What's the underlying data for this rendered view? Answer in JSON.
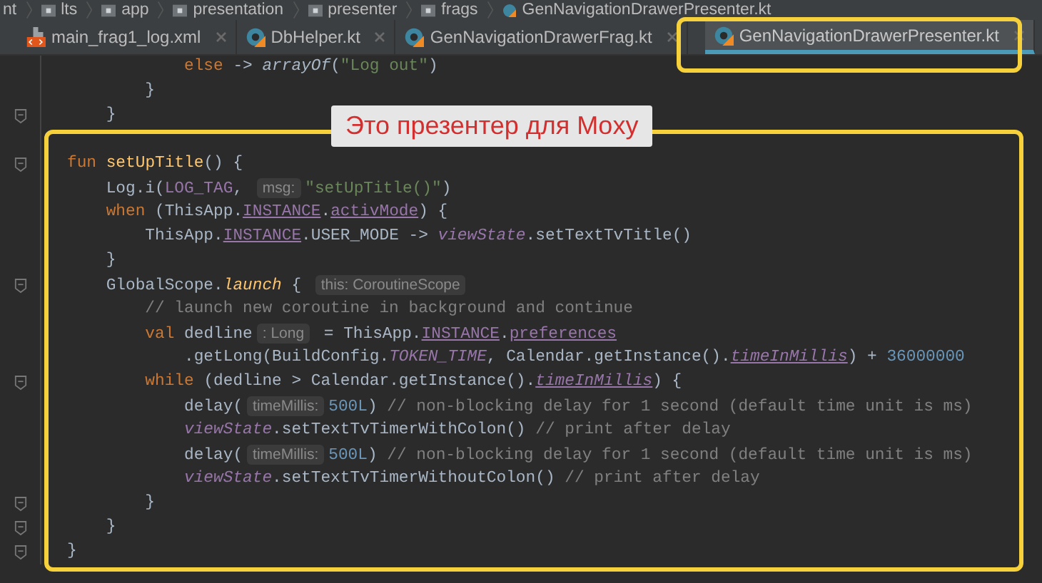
{
  "breadcrumbs": [
    {
      "label": "nt",
      "kind": "plain"
    },
    {
      "label": "lts",
      "kind": "folder"
    },
    {
      "label": "app",
      "kind": "folder"
    },
    {
      "label": "presentation",
      "kind": "folder"
    },
    {
      "label": "presenter",
      "kind": "folder"
    },
    {
      "label": "frags",
      "kind": "folder"
    },
    {
      "label": "GenNavigationDrawerPresenter.kt",
      "kind": "kotlin"
    }
  ],
  "tabs": [
    {
      "label": "main_frag1_log.xml",
      "kind": "xml",
      "selected": false
    },
    {
      "label": "DbHelper.kt",
      "kind": "kotlin",
      "selected": false
    },
    {
      "label": "GenNavigationDrawerFrag.kt",
      "kind": "kotlin",
      "selected": false
    },
    {
      "label": "GenNavigationDrawerPresenter.kt",
      "kind": "kotlin",
      "selected": true
    }
  ],
  "code": [
    {
      "fold": false,
      "tokens": [
        {
          "t": "            else",
          "kind": "keyword"
        },
        {
          "t": " -> ",
          "kind": "plain"
        },
        {
          "t": "arrayOf",
          "kind": "call-i"
        },
        {
          "t": "(",
          "kind": "plain"
        },
        {
          "t": "\"Log out\"",
          "kind": "string"
        },
        {
          "t": ")",
          "kind": "plain"
        }
      ]
    },
    {
      "fold": false,
      "tokens": [
        {
          "t": "        }",
          "kind": "plain"
        }
      ]
    },
    {
      "fold": true,
      "tokens": [
        {
          "t": "    }",
          "kind": "plain"
        }
      ]
    },
    {
      "fold": false
    },
    {
      "fold": true,
      "tokens": [
        {
          "t": "fun",
          "kind": "keyword"
        },
        {
          "t": " setUpTitle",
          "kind": "decl"
        },
        {
          "t": "() {",
          "kind": "plain"
        }
      ]
    },
    {
      "fold": false,
      "tokens": [
        {
          "t": "    Log.i(",
          "kind": "plain"
        },
        {
          "t": "LOG_TAG",
          "kind": "prop"
        },
        {
          "t": ", ",
          "kind": "plain"
        },
        {
          "t": "msg:",
          "kind": "hint"
        },
        {
          "t": "\"setUpTitle()\"",
          "kind": "string"
        },
        {
          "t": ")",
          "kind": "plain"
        }
      ]
    },
    {
      "fold": false,
      "tokens": [
        {
          "t": "    when",
          "kind": "keyword"
        },
        {
          "t": " (ThisApp.",
          "kind": "plain"
        },
        {
          "t": "INSTANCE",
          "kind": "prop-u"
        },
        {
          "t": ".",
          "kind": "plain"
        },
        {
          "t": "activMode",
          "kind": "prop-u"
        },
        {
          "t": ") {",
          "kind": "plain"
        }
      ]
    },
    {
      "fold": false,
      "tokens": [
        {
          "t": "        ThisApp.",
          "kind": "plain"
        },
        {
          "t": "INSTANCE",
          "kind": "prop-u"
        },
        {
          "t": ".USER_MODE -> ",
          "kind": "plain"
        },
        {
          "t": "viewState",
          "kind": "prop-i"
        },
        {
          "t": ".setTextTvTitle()",
          "kind": "plain"
        }
      ]
    },
    {
      "fold": false,
      "tokens": [
        {
          "t": "    }",
          "kind": "plain"
        }
      ]
    },
    {
      "fold": true,
      "tokens": [
        {
          "t": "    GlobalScope.",
          "kind": "plain"
        },
        {
          "t": "launch",
          "kind": "ext-call"
        },
        {
          "t": " { ",
          "kind": "plain"
        },
        {
          "t": "this: CoroutineScope",
          "kind": "hint"
        }
      ]
    },
    {
      "fold": false,
      "tokens": [
        {
          "t": "        // launch new coroutine in background and continue",
          "kind": "comment"
        }
      ]
    },
    {
      "fold": false,
      "tokens": [
        {
          "t": "        val",
          "kind": "keyword"
        },
        {
          "t": " dedline",
          "kind": "plain"
        },
        {
          "t": ": Long",
          "kind": "hint"
        },
        {
          "t": " = ThisApp.",
          "kind": "plain"
        },
        {
          "t": "INSTANCE",
          "kind": "prop-u"
        },
        {
          "t": ".",
          "kind": "plain"
        },
        {
          "t": "preferences",
          "kind": "prop-u"
        }
      ]
    },
    {
      "fold": false,
      "tokens": [
        {
          "t": "            .getLong(BuildConfig.",
          "kind": "plain"
        },
        {
          "t": "TOKEN_TIME",
          "kind": "prop-i"
        },
        {
          "t": ", Calendar.getInstance().",
          "kind": "plain"
        },
        {
          "t": "timeInMillis",
          "kind": "prop-iu"
        },
        {
          "t": ") + ",
          "kind": "plain"
        },
        {
          "t": "36000000",
          "kind": "number"
        }
      ]
    },
    {
      "fold": true,
      "tokens": [
        {
          "t": "        while",
          "kind": "keyword"
        },
        {
          "t": " (dedline > Calendar.getInstance().",
          "kind": "plain"
        },
        {
          "t": "timeInMillis",
          "kind": "prop-iu"
        },
        {
          "t": ") {",
          "kind": "plain"
        }
      ]
    },
    {
      "fold": false,
      "tokens": [
        {
          "t": "            delay(",
          "kind": "plain"
        },
        {
          "t": "timeMillis:",
          "kind": "hint"
        },
        {
          "t": "500L",
          "kind": "number"
        },
        {
          "t": ") ",
          "kind": "plain"
        },
        {
          "t": "// non-blocking delay for 1 second (default time unit is ms)",
          "kind": "comment"
        }
      ]
    },
    {
      "fold": false,
      "tokens": [
        {
          "t": "            viewState",
          "kind": "prop-i"
        },
        {
          "t": ".setTextTvTimerWithColon() ",
          "kind": "plain"
        },
        {
          "t": "// print after delay",
          "kind": "comment"
        }
      ]
    },
    {
      "fold": false,
      "tokens": [
        {
          "t": "            delay(",
          "kind": "plain"
        },
        {
          "t": "timeMillis:",
          "kind": "hint"
        },
        {
          "t": "500L",
          "kind": "number"
        },
        {
          "t": ") ",
          "kind": "plain"
        },
        {
          "t": "// non-blocking delay for 1 second (default time unit is ms)",
          "kind": "comment"
        }
      ]
    },
    {
      "fold": false,
      "tokens": [
        {
          "t": "            viewState",
          "kind": "prop-i"
        },
        {
          "t": ".setTextTvTimerWithoutColon() ",
          "kind": "plain"
        },
        {
          "t": "// print after delay",
          "kind": "comment"
        }
      ]
    },
    {
      "fold": true,
      "tokens": [
        {
          "t": "        }",
          "kind": "plain"
        }
      ]
    },
    {
      "fold": true,
      "tokens": [
        {
          "t": "    }",
          "kind": "plain"
        }
      ]
    },
    {
      "fold": true,
      "tokens": [
        {
          "t": "}",
          "kind": "plain"
        }
      ]
    }
  ],
  "annotation": {
    "label": "Это презентер для Moxy"
  }
}
